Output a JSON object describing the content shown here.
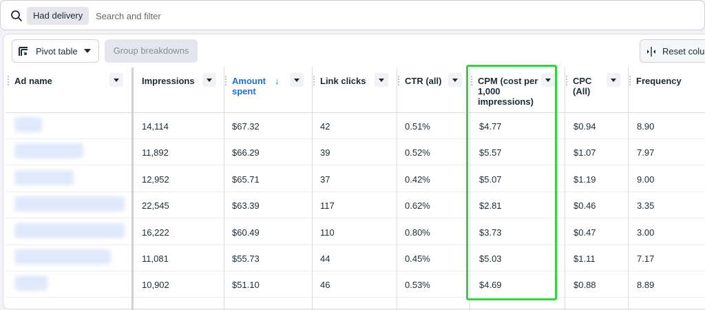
{
  "search": {
    "chip_label": "Had delivery",
    "placeholder": "Search and filter"
  },
  "toolbar": {
    "pivot_label": "Pivot table",
    "group_label": "Group breakdowns",
    "reset_label": "Reset colu"
  },
  "table": {
    "columns": [
      {
        "label": "Ad name"
      },
      {
        "label": "Impressions"
      },
      {
        "label": "Amount spent",
        "sort": "desc"
      },
      {
        "label": "Link clicks"
      },
      {
        "label": "CTR (all)"
      },
      {
        "label": "CPM (cost per 1,000 impressions)"
      },
      {
        "label": "CPC (All)"
      },
      {
        "label": "Frequency"
      }
    ],
    "sort_arrow": "↓",
    "rows": [
      {
        "impressions": "14,114",
        "amount": "$67.32",
        "clicks": "42",
        "ctr": "0.51%",
        "cpm": "$4.77",
        "cpc": "$0.94",
        "freq": "8.90"
      },
      {
        "impressions": "11,892",
        "amount": "$66.29",
        "clicks": "39",
        "ctr": "0.52%",
        "cpm": "$5.57",
        "cpc": "$1.07",
        "freq": "7.97"
      },
      {
        "impressions": "12,952",
        "amount": "$65.71",
        "clicks": "37",
        "ctr": "0.42%",
        "cpm": "$5.07",
        "cpc": "$1.19",
        "freq": "9.00"
      },
      {
        "impressions": "22,545",
        "amount": "$63.39",
        "clicks": "117",
        "ctr": "0.62%",
        "cpm": "$2.81",
        "cpc": "$0.46",
        "freq": "3.35"
      },
      {
        "impressions": "16,222",
        "amount": "$60.49",
        "clicks": "110",
        "ctr": "0.80%",
        "cpm": "$3.73",
        "cpc": "$0.47",
        "freq": "3.00"
      },
      {
        "impressions": "11,081",
        "amount": "$55.73",
        "clicks": "44",
        "ctr": "0.45%",
        "cpm": "$5.03",
        "cpc": "$1.11",
        "freq": "7.17"
      },
      {
        "impressions": "10,902",
        "amount": "$51.10",
        "clicks": "46",
        "ctr": "0.53%",
        "cpm": "$4.69",
        "cpc": "$0.88",
        "freq": "8.89"
      }
    ]
  },
  "colors": {
    "highlight": "#2fd63b",
    "sorted_header": "#1a6ed8"
  }
}
